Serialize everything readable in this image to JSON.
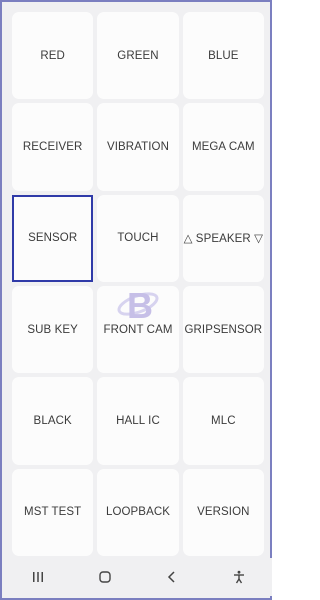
{
  "tiles": [
    {
      "label": "RED"
    },
    {
      "label": "GREEN"
    },
    {
      "label": "BLUE"
    },
    {
      "label": "RECEIVER"
    },
    {
      "label": "VIBRATION"
    },
    {
      "label": "MEGA CAM"
    },
    {
      "label": "SENSOR"
    },
    {
      "label": "TOUCH"
    },
    {
      "label": "△ SPEAKER ▽"
    },
    {
      "label": "SUB KEY"
    },
    {
      "label": "FRONT CAM"
    },
    {
      "label": "GRIPSENSOR"
    },
    {
      "label": "BLACK"
    },
    {
      "label": "HALL IC"
    },
    {
      "label": "MLC"
    },
    {
      "label": "MST TEST"
    },
    {
      "label": "LOOPBACK"
    },
    {
      "label": "VERSION"
    }
  ],
  "selected_tile": "SENSOR",
  "watermark": {
    "letter": "B",
    "color": "#9a8fd6"
  },
  "navbar": {
    "buttons": [
      "recent-apps",
      "home",
      "back",
      "accessibility"
    ]
  },
  "colors": {
    "background": "#f0f0f2",
    "tile": "#fcfcfc",
    "text": "#3b3b3b",
    "selection": "#2f3aa8",
    "frame": "#7b7fc0"
  }
}
